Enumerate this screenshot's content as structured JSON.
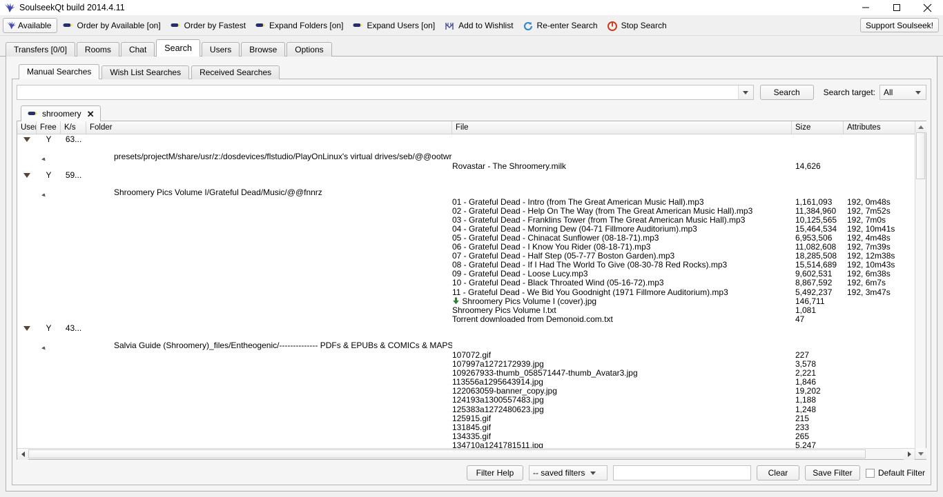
{
  "window": {
    "title": "SoulseekQt build 2014.4.11",
    "icon": "soulseek-bird-icon",
    "controls": {
      "minimize": "—",
      "maximize": "□",
      "close": "✕"
    }
  },
  "toolbar": {
    "status_button": {
      "label": "Available",
      "icon": "soulseek-bird-icon"
    },
    "items": [
      {
        "label": "Order by Available [on]",
        "icon": "pill-icon"
      },
      {
        "label": "Order by Fastest",
        "icon": "pill-icon"
      },
      {
        "label": "Expand Folders [on]",
        "icon": "pill-icon"
      },
      {
        "label": "Expand Users [on]",
        "icon": "pill-icon"
      },
      {
        "label": "Add to Wishlist",
        "icon": "wishlist-icon"
      },
      {
        "label": "Re-enter Search",
        "icon": "refresh-icon"
      },
      {
        "label": "Stop Search",
        "icon": "stop-icon"
      }
    ],
    "support_label": "Support Soulseek!"
  },
  "main_tabs": [
    {
      "label": "Transfers [0/0]",
      "active": false
    },
    {
      "label": "Rooms",
      "active": false
    },
    {
      "label": "Chat",
      "active": false
    },
    {
      "label": "Search",
      "active": true
    },
    {
      "label": "Users",
      "active": false
    },
    {
      "label": "Browse",
      "active": false
    },
    {
      "label": "Options",
      "active": false
    }
  ],
  "search_tabs": [
    {
      "label": "Manual Searches",
      "active": true
    },
    {
      "label": "Wish List Searches",
      "active": false
    },
    {
      "label": "Received Searches",
      "active": false
    }
  ],
  "search_bar": {
    "query": "",
    "placeholder": "",
    "search_button": "Search",
    "target_label": "Search target:",
    "target_value": "All"
  },
  "result_tab": {
    "label": "shroomery",
    "close": "✕",
    "icon": "pill-icon"
  },
  "columns": [
    "User",
    "Free",
    "K/s",
    "Folder",
    "File",
    "Size",
    "Attributes"
  ],
  "results": [
    {
      "user": "",
      "free": "Y",
      "kbs": "63...",
      "folder": "presets/projectM/share/usr/z:/dosdevices/flstudio/PlayOnLinux's virtual drives/seb/@@ootwr",
      "files": [
        {
          "name": "Rovastar - The Shroomery.milk",
          "size": "14,626",
          "attributes": "",
          "icon": ""
        }
      ]
    },
    {
      "user": "",
      "free": "Y",
      "kbs": "59...",
      "folder": "Shroomery Pics Volume I/Grateful Dead/Music/@@fnnrz",
      "files": [
        {
          "name": "01 - Grateful Dead - Intro (from The Great American Music Hall).mp3",
          "size": "1,161,093",
          "attributes": "192, 0m48s",
          "icon": ""
        },
        {
          "name": "02 - Grateful Dead - Help On The Way (from The Great American Music Hall).mp3",
          "size": "11,384,960",
          "attributes": "192, 7m52s",
          "icon": ""
        },
        {
          "name": "03 - Grateful Dead - Franklins Tower (from The Great American Music Hall).mp3",
          "size": "10,125,565",
          "attributes": "192, 7m0s",
          "icon": ""
        },
        {
          "name": "04 - Grateful Dead - Morning Dew (04-71 Fillmore Auditorium).mp3",
          "size": "15,464,534",
          "attributes": "192, 10m41s",
          "icon": ""
        },
        {
          "name": "05 - Grateful Dead - Chinacat Sunflower (08-18-71).mp3",
          "size": "6,953,506",
          "attributes": "192, 4m48s",
          "icon": ""
        },
        {
          "name": "06 - Grateful Dead - I Know You Rider (08-18-71).mp3",
          "size": "11,082,608",
          "attributes": "192, 7m39s",
          "icon": ""
        },
        {
          "name": "07 - Grateful Dead - Half Step (05-7-77 Boston Garden).mp3",
          "size": "18,285,508",
          "attributes": "192, 12m38s",
          "icon": ""
        },
        {
          "name": "08 - Grateful Dead - If I Had The World To Give (08-30-78 Red Rocks).mp3",
          "size": "15,514,689",
          "attributes": "192, 10m43s",
          "icon": ""
        },
        {
          "name": "09 - Grateful Dead - Loose Lucy.mp3",
          "size": "9,602,531",
          "attributes": "192, 6m38s",
          "icon": ""
        },
        {
          "name": "10 - Grateful Dead - Black Throated Wind (05-16-72).mp3",
          "size": "8,867,592",
          "attributes": "192, 6m7s",
          "icon": ""
        },
        {
          "name": "11 - Grateful Dead - We Bid You Goodnight (1971 Fillmore Auditorium).mp3",
          "size": "5,492,237",
          "attributes": "192, 3m47s",
          "icon": ""
        },
        {
          "name": "Shroomery Pics Volume I (cover).jpg",
          "size": "146,711",
          "attributes": "",
          "icon": "download-arrow-icon"
        },
        {
          "name": "Shroomery Pics Volume I.txt",
          "size": "1,081",
          "attributes": "",
          "icon": ""
        },
        {
          "name": "Torrent downloaded from Demonoid.com.txt",
          "size": "47",
          "attributes": "",
          "icon": ""
        }
      ]
    },
    {
      "user": "",
      "free": "Y",
      "kbs": "43...",
      "folder": "Salvia Guide (Shroomery)_files/Entheogenic/-------------- PDFs & EPUBs & COMICs & MAPS --------------/Do...",
      "files": [
        {
          "name": "107072.gif",
          "size": "227",
          "attributes": "",
          "icon": ""
        },
        {
          "name": "107997a1272172939.jpg",
          "size": "3,578",
          "attributes": "",
          "icon": ""
        },
        {
          "name": "109267933-thumb_058571447-thumb_Avatar3.jpg",
          "size": "2,221",
          "attributes": "",
          "icon": ""
        },
        {
          "name": "113556a1295643914.jpg",
          "size": "1,846",
          "attributes": "",
          "icon": ""
        },
        {
          "name": "122063059-banner_copy.jpg",
          "size": "19,202",
          "attributes": "",
          "icon": ""
        },
        {
          "name": "124193a1300557483.jpg",
          "size": "1,188",
          "attributes": "",
          "icon": ""
        },
        {
          "name": "125383a1272480623.jpg",
          "size": "1,248",
          "attributes": "",
          "icon": ""
        },
        {
          "name": "125915.gif",
          "size": "215",
          "attributes": "",
          "icon": ""
        },
        {
          "name": "131845.gif",
          "size": "233",
          "attributes": "",
          "icon": ""
        },
        {
          "name": "134335.gif",
          "size": "265",
          "attributes": "",
          "icon": ""
        },
        {
          "name": "134710a1241781511.jpg",
          "size": "5,247",
          "attributes": "",
          "icon": ""
        }
      ]
    }
  ],
  "filter_bar": {
    "filter_help": "Filter Help",
    "saved_filters": "-- saved filters",
    "filter_value": "",
    "clear": "Clear",
    "save_filter": "Save Filter",
    "default_filter": "Default Filter",
    "default_filter_checked": false
  }
}
